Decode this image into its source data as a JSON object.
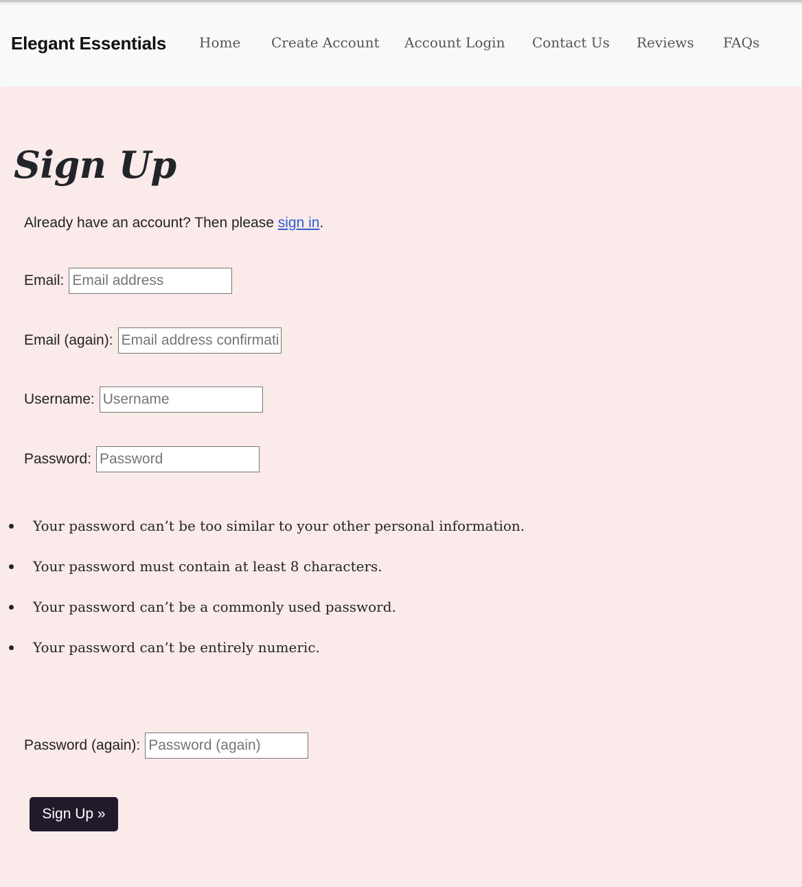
{
  "navbar": {
    "brand": "Elegant Essentials",
    "links": [
      "Home",
      "Create Account",
      "Account Login",
      "Contact Us",
      "Reviews",
      "FAQs"
    ]
  },
  "page": {
    "title": "Sign Up",
    "intro_text": "Already have an account? Then please ",
    "intro_link": "sign in",
    "intro_end": "."
  },
  "form": {
    "email": {
      "label": "Email:",
      "placeholder": "Email address",
      "value": ""
    },
    "email_again": {
      "label": "Email (again):",
      "placeholder": "Email address confirmation",
      "value": ""
    },
    "username": {
      "label": "Username:",
      "placeholder": "Username",
      "value": ""
    },
    "password": {
      "label": "Password:",
      "placeholder": "Password",
      "value": ""
    },
    "password_rules": [
      "Your password can’t be too similar to your other personal information.",
      "Your password must contain at least 8 characters.",
      "Your password can’t be a commonly used password.",
      "Your password can’t be entirely numeric."
    ],
    "password_again": {
      "label": "Password (again):",
      "placeholder": "Password (again)",
      "value": ""
    },
    "submit_label": "Sign Up »"
  },
  "colors": {
    "page_background": "#fbeaea",
    "navbar_background": "#f8f9fa",
    "link": "#2f5fd0",
    "button_background": "#221a2b"
  }
}
